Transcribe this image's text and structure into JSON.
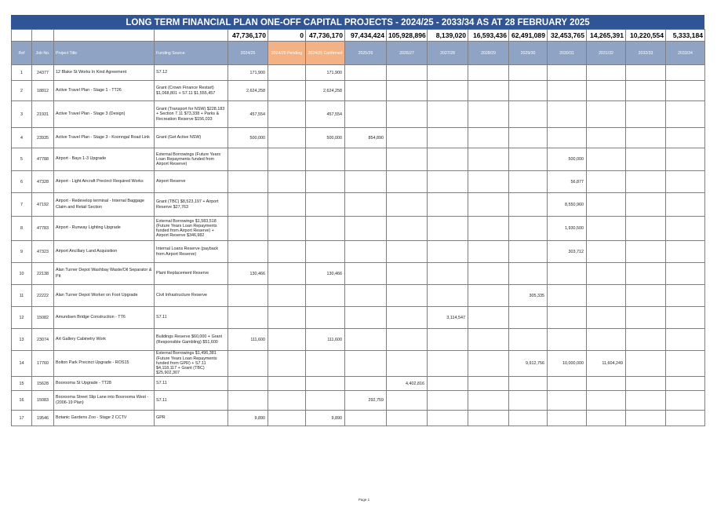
{
  "title": "LONG TERM FINANCIAL PLAN ONE-OFF CAPITAL PROJECTS - 2024/25 - 2033/34 AS AT 28 FEBRUARY 2025",
  "totals": [
    "47,736,170",
    "0",
    "47,736,170",
    "97,434,424",
    "105,928,896",
    "8,139,020",
    "16,593,436",
    "62,491,089",
    "32,453,765",
    "14,265,391",
    "10,220,554",
    "5,333,184"
  ],
  "headers": {
    "ref": "Ref",
    "job": "Job No.",
    "project": "Project Title",
    "funding": "Funding Source",
    "years": [
      "2024/25",
      "2024/25 Pending",
      "2024/25 Confirmed",
      "2025/26",
      "2026/27",
      "2027/28",
      "2028/29",
      "2029/30",
      "2030/31",
      "2031/32",
      "2032/33",
      "2033/34"
    ]
  },
  "rows": [
    {
      "ref": "1",
      "job": "24377",
      "title": "12 Blake St Works In Kind Agreement",
      "source": "S7.12",
      "values": [
        "171,900",
        "",
        "171,900",
        "",
        "",
        "",
        "",
        "",
        "",
        "",
        "",
        ""
      ]
    },
    {
      "ref": "2",
      "job": "18812",
      "title": "Active Travel Plan - Stage 1 - TT26",
      "source": "Grant (Crown Finance Restart) $1,068,801 + S7.11 $1,555,457",
      "values": [
        "2,624,258",
        "",
        "2,624,258",
        "",
        "",
        "",
        "",
        "",
        "",
        "",
        "",
        ""
      ]
    },
    {
      "ref": "3",
      "job": "21931",
      "title": "Active Travel Plan - Stage 3 (Design)",
      "source": "Grant (Transport for NSW) $228,183 + Section 7.11 $73,338 + Parks & Recreation Reserve $156,033",
      "values": [
        "457,554",
        "",
        "457,554",
        "",
        "",
        "",
        "",
        "",
        "",
        "",
        "",
        ""
      ]
    },
    {
      "ref": "4",
      "job": "23935",
      "title": "Active Travel Plan - Stage 3 - Koonngal Road Link",
      "source": "Grant (Get Active NSW)",
      "values": [
        "500,000",
        "",
        "500,000",
        "854,890",
        "",
        "",
        "",
        "",
        "",
        "",
        "",
        ""
      ]
    },
    {
      "ref": "5",
      "job": "47788",
      "title": "Airport - Bays 1-3 Upgrade",
      "source": "External Borrowings (Future Years Loan Repayments funded from Airport Reserve)",
      "values": [
        "",
        "",
        "",
        "",
        "",
        "",
        "",
        "",
        "500,000",
        "",
        "",
        ""
      ]
    },
    {
      "ref": "6",
      "job": "47328",
      "title": "Airport - Light Aircraft Precinct Required Works",
      "source": "Airport Reserve",
      "values": [
        "",
        "",
        "",
        "",
        "",
        "",
        "",
        "",
        "56,877",
        "",
        "",
        ""
      ]
    },
    {
      "ref": "7",
      "job": "47192",
      "title": "Airport - Redevelop terminal - Internal Baggage Claim and Retail Section",
      "source": "Grant (TBC) $8,523,197 + Airport Reserve $27,763",
      "values": [
        "",
        "",
        "",
        "",
        "",
        "",
        "",
        "",
        "8,550,960",
        "",
        "",
        ""
      ]
    },
    {
      "ref": "8",
      "job": "47783",
      "title": "Airport - Runway Lighting Upgrade",
      "source": "External Borrowings $1,583,518 (Future Years Loan Repayments funded from Airport Reserve) + Airport Reserve $346,982",
      "values": [
        "",
        "",
        "",
        "",
        "",
        "",
        "",
        "",
        "1,930,500",
        "",
        "",
        ""
      ]
    },
    {
      "ref": "9",
      "job": "47323",
      "title": "Airport Ancillary Land Acquisition",
      "source": "Internal Loans Reserve (payback from Airport Reserve)",
      "values": [
        "",
        "",
        "",
        "",
        "",
        "",
        "",
        "",
        "303,712",
        "",
        "",
        ""
      ]
    },
    {
      "ref": "10",
      "job": "22138",
      "title": "Alan Turner Depot Washbay Waste/Oil Separator & Pit",
      "source": "Plant Replacement Reserve",
      "values": [
        "130,466",
        "",
        "130,466",
        "",
        "",
        "",
        "",
        "",
        "",
        "",
        "",
        ""
      ]
    },
    {
      "ref": "11",
      "job": "22222",
      "title": "Alan Turner Depot Worker on Foot Upgrade",
      "source": "Civil Infrastructure Reserve",
      "values": [
        "",
        "",
        "",
        "",
        "",
        "",
        "",
        "305,335",
        "",
        "",
        "",
        ""
      ]
    },
    {
      "ref": "12",
      "job": "15082",
      "title": "Amundsen Bridge Construction - TT6",
      "source": "S7.11",
      "values": [
        "",
        "",
        "",
        "",
        "",
        "3,114,547",
        "",
        "",
        "",
        "",
        "",
        ""
      ]
    },
    {
      "ref": "13",
      "job": "23074",
      "title": "Art Gallery Cabinetry Work",
      "source": "Buildings Reserve $60,000 + Grant (Responsible Gambling) $51,600",
      "values": [
        "111,600",
        "",
        "111,600",
        "",
        "",
        "",
        "",
        "",
        "",
        "",
        "",
        ""
      ]
    },
    {
      "ref": "14",
      "job": "17760",
      "title": "Bolton Park Precinct Upgrade - ROS15",
      "source": "External Borrowings $1,496,381 (Future Years Loan Repayments funded from GPR) + S7.11 $4,118,117 + Grant (TBC) $25,902,307",
      "values": [
        "",
        "",
        "",
        "",
        "",
        "",
        "",
        "9,912,756",
        "10,000,000",
        "11,604,249",
        "",
        ""
      ]
    },
    {
      "ref": "15",
      "job": "15628",
      "title": "Boorooma St Upgrade - TT28",
      "source": "S7.11",
      "values": [
        "",
        "",
        "",
        "",
        "4,402,816",
        "",
        "",
        "",
        "",
        "",
        "",
        ""
      ]
    },
    {
      "ref": "16",
      "job": "15083",
      "title": "Boorooma Street Slip Lane into Boorooma West - (2006-19 Plan)",
      "source": "S7.11",
      "values": [
        "",
        "",
        "",
        "292,759",
        "",
        "",
        "",
        "",
        "",
        "",
        "",
        ""
      ]
    },
    {
      "ref": "17",
      "job": "19546",
      "title": "Botanic Gardens Zoo - Stage 2 CCTV",
      "source": "GPR",
      "values": [
        "9,890",
        "",
        "9,890",
        "",
        "",
        "",
        "",
        "",
        "",
        "",
        "",
        ""
      ]
    }
  ],
  "footer": "Page 1",
  "colors": {
    "title_bg": "#2f5597",
    "header_bg": "#8fa3c4",
    "pending_bg": "#f4b183"
  }
}
